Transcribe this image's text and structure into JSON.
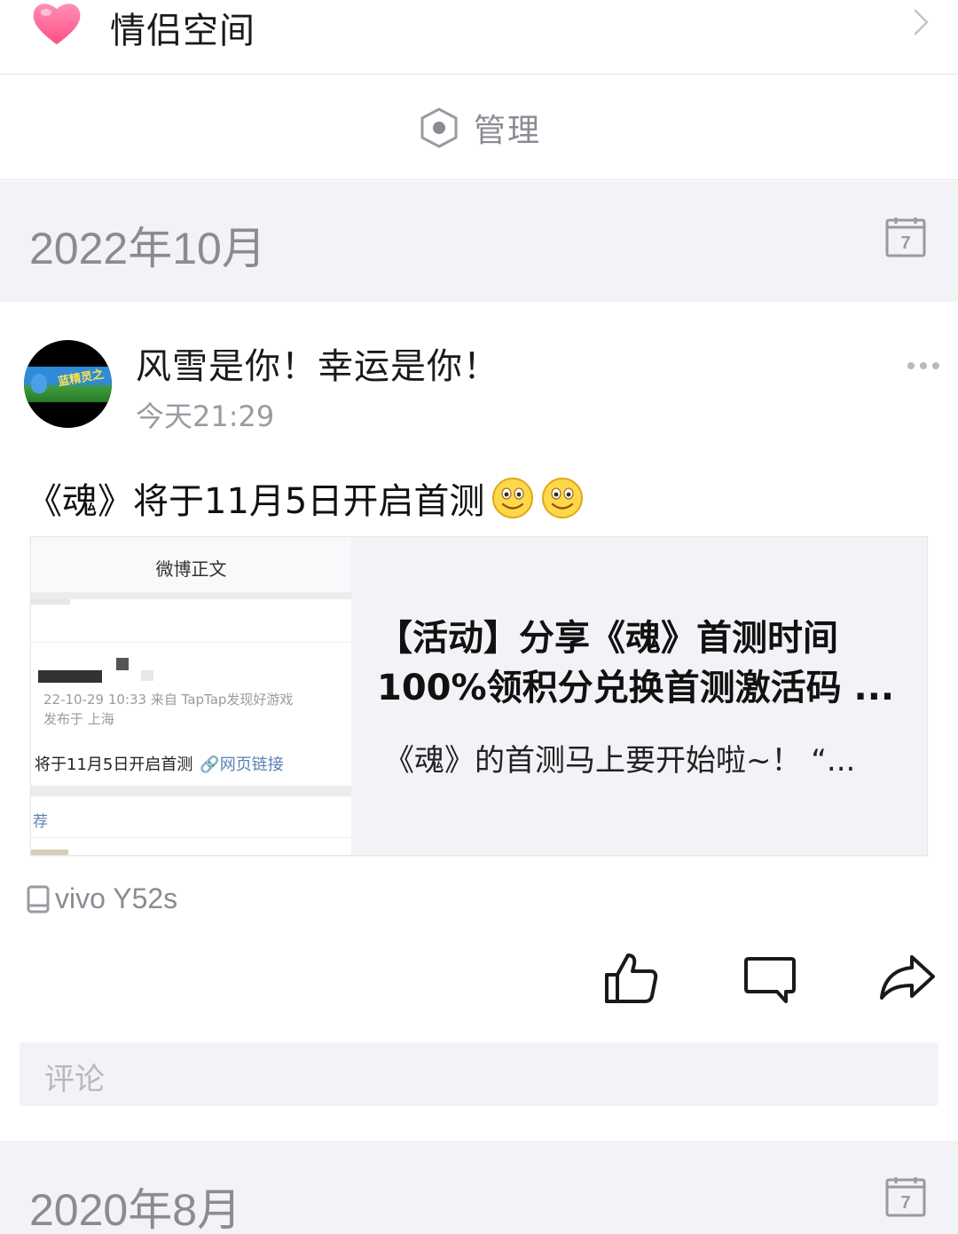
{
  "colors": {
    "accent_heart": "#ff6b9a",
    "muted": "#8b8b93",
    "section_bg": "#f2f3f7",
    "link": "#5a7fb5"
  },
  "couple_space": {
    "icon": "heart-icon",
    "label": "情侣空间"
  },
  "manage": {
    "icon": "hexagon-settings-icon",
    "label": "管理"
  },
  "months": [
    {
      "label": "2022年10月",
      "icon": "calendar-icon",
      "calendar_day": "7"
    },
    {
      "label": "2020年8月",
      "icon": "calendar-icon",
      "calendar_day": "7"
    }
  ],
  "post": {
    "author": "风雪是你！幸运是你！",
    "time": "今天21:29",
    "text": "《魂》将于11月5日开启首测",
    "emojis": [
      "smiley-icon",
      "smiley-icon"
    ],
    "card": {
      "thumb_header": "微博正文",
      "thumb_meta1": "22-10-29 10:33  来自 TapTap发现好游戏",
      "thumb_meta2": "发布于 上海",
      "thumb_body": "将于11月5日开启首测",
      "thumb_link": "网页链接",
      "thumb_rec": "荐",
      "title": "【活动】分享《魂》首测时间100%领积分兑换首测激活码 ...",
      "desc": "《魂》的首测马上要开始啦~！ “..."
    },
    "device": "vivo Y52s",
    "actions": [
      "like-icon",
      "comment-icon",
      "share-icon"
    ],
    "comment_placeholder": "评论"
  }
}
